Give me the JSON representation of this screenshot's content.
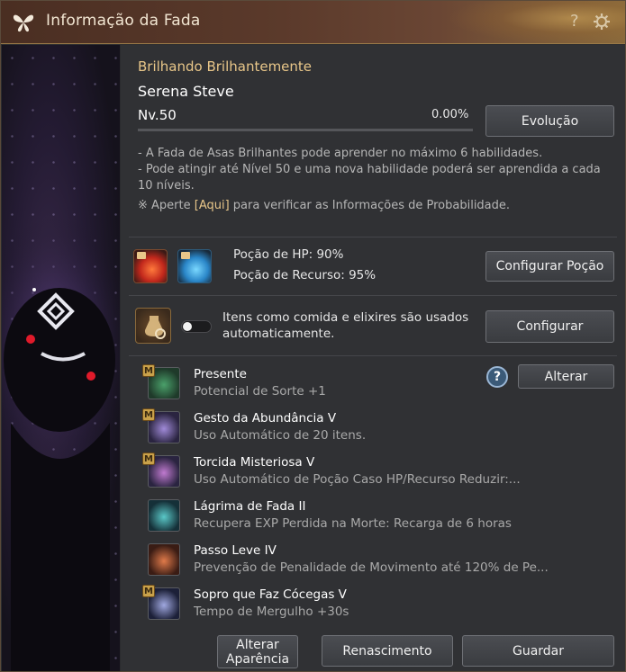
{
  "window": {
    "title": "Informação da Fada",
    "title_icon": "butterfly-icon",
    "help_glyph": "?",
    "colors": {
      "accent_gold": "#e8c689",
      "title_bar": "#5b3a2b",
      "panel": "#303134"
    }
  },
  "fairy": {
    "title": "Brilhando Brilhantemente",
    "name": "Serena Steve",
    "level": "Nv.50",
    "exp_percent": "0.00%",
    "exp_fraction": 0.0,
    "evolution_button": "Evolução"
  },
  "info": {
    "line1": "- A Fada de Asas Brilhantes pode aprender no máximo 6 habilidades.",
    "line2": "- Pode atingir até Nível 50 e uma nova habilidade poderá ser aprendida a cada 10 níveis.",
    "note_prefix": "※ Aperte ",
    "note_link": "[Aqui]",
    "note_suffix": " para verificar as Informações de Probabilidade."
  },
  "potions": {
    "hp_label": "Poção de HP: 90%",
    "mp_label": "Poção de Recurso: 95%",
    "configure_button": "Configurar Poção",
    "hp_icon": "red-potion-icon",
    "mp_icon": "blue-potion-icon"
  },
  "auto_use": {
    "text": "Itens como comida e elixires são usados automaticamente.",
    "toggle_on": false,
    "configure_button": "Configurar",
    "icon": "elixir-gear-icon"
  },
  "skills": [
    {
      "name": "Presente",
      "desc": "Potencial de Sorte +1",
      "master": true,
      "badge": "M",
      "icon": "clover-icon"
    },
    {
      "name": "Gesto da Abundância V",
      "desc": "Uso Automático de 20 itens.",
      "master": true,
      "badge": "M",
      "icon": "fairy-wings-icon"
    },
    {
      "name": "Torcida Misteriosa V",
      "desc": "Uso Automático de Poção Caso HP/Recurso Reduzir:...",
      "master": true,
      "badge": "M",
      "icon": "potion-swirl-icon"
    },
    {
      "name": "Lágrima de Fada II",
      "desc": "Recupera EXP Perdida na Morte: Recarga de 6 horas",
      "master": false,
      "badge": "",
      "icon": "fairy-tear-icon"
    },
    {
      "name": "Passo Leve IV",
      "desc": "Prevenção de Penalidade de Movimento até 120% de Pe...",
      "master": false,
      "badge": "",
      "icon": "light-step-icon"
    },
    {
      "name": "Sopro que Faz Cócegas V",
      "desc": "Tempo de Mergulho +30s",
      "master": true,
      "badge": "M",
      "icon": "breath-bubble-icon"
    }
  ],
  "skills_controls": {
    "help_glyph": "?",
    "change_button": "Alterar"
  },
  "footer": {
    "appearance_button": "Alterar Aparência",
    "rebirth_button": "Renascimento",
    "store_button": "Guardar"
  }
}
